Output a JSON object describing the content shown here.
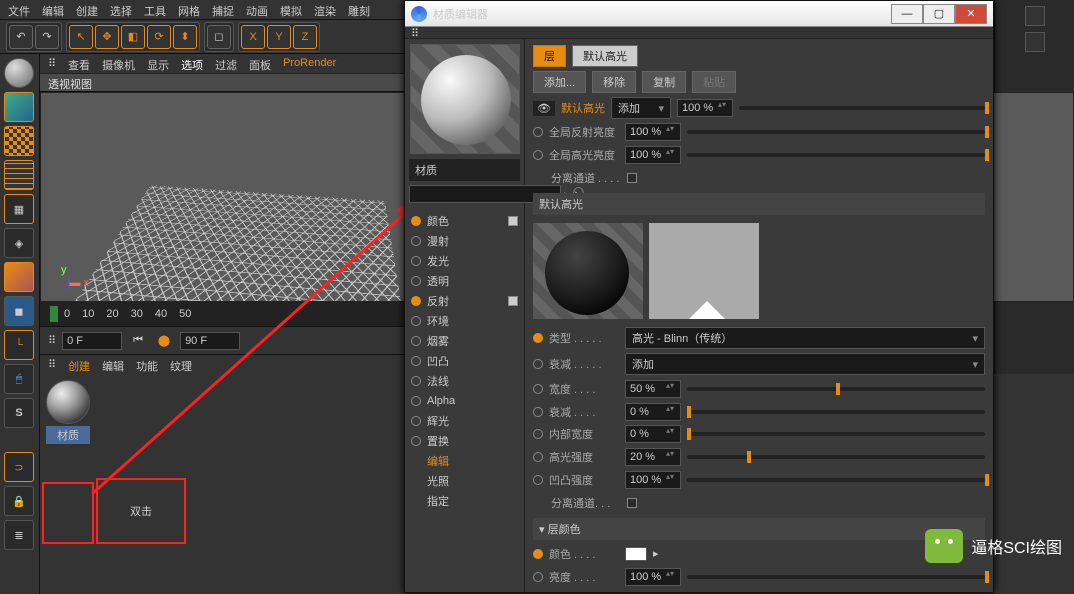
{
  "menu": {
    "file": "文件",
    "edit": "编辑",
    "create": "创建",
    "select": "选择",
    "tool": "工具",
    "mesh": "网格",
    "capture": "捕捉",
    "anim": "动画",
    "sim": "模拟",
    "render": "渲染",
    "sculpt": "雕刻"
  },
  "tool_letters": {
    "x": "X",
    "y": "Y",
    "z": "Z"
  },
  "vpmenu": {
    "view": "查看",
    "camera": "摄像机",
    "display": "显示",
    "options": "选项",
    "filter": "过滤",
    "panel": "面板",
    "pro": "ProRender"
  },
  "vp_label": "透视视图",
  "axis": {
    "x": "x",
    "y": "y"
  },
  "timeline": {
    "ticks": [
      "0",
      "10",
      "20",
      "30",
      "40",
      "50"
    ],
    "g": "0"
  },
  "play": {
    "start": "0 F",
    "end": "90 F"
  },
  "matmenu": {
    "create": "创建",
    "edit": "编辑",
    "fn": "功能",
    "tex": "纹理"
  },
  "mat_label": "材质",
  "doubleclick": "双击",
  "dialog": {
    "title": "材质编辑器",
    "matname": "材质",
    "channels": [
      {
        "name": "颜色",
        "on": true,
        "chk": true
      },
      {
        "name": "漫射",
        "on": false
      },
      {
        "name": "发光",
        "on": false
      },
      {
        "name": "透明",
        "on": false
      },
      {
        "name": "反射",
        "on": true,
        "chk": true,
        "sel": true
      },
      {
        "name": "环境",
        "on": false
      },
      {
        "name": "烟雾",
        "on": false
      },
      {
        "name": "凹凸",
        "on": false
      },
      {
        "name": "法线",
        "on": false
      },
      {
        "name": "Alpha",
        "on": false
      },
      {
        "name": "辉光",
        "on": false
      },
      {
        "name": "置换",
        "on": false
      }
    ],
    "extra": [
      "编辑",
      "光照",
      "指定"
    ],
    "tabs": {
      "layer": "层",
      "spec": "默认高光"
    },
    "ops": {
      "add": "添加...",
      "remove": "移除",
      "copy": "复制",
      "paste": "粘贴"
    },
    "spec_label": "默认高光",
    "add_dd": "添加",
    "pct100": "100 %",
    "global_ref": "全局反射亮度",
    "global_spec": "全局高光亮度",
    "sep_chan": "分离通道 . . . .",
    "sect_spec": "默认高光",
    "type": "类型 . . . . .",
    "type_val": "高光 - Blinn（传统）",
    "atten": "衰减 . . . . .",
    "atten_val": "添加",
    "width": "宽度 . . . .",
    "width_val": "50 %",
    "falloff": "衰减 . . . .",
    "falloff_val": "0 %",
    "inner": "内部宽度",
    "inner_val": "0 %",
    "spec_str": "高光强度",
    "spec_str_val": "20 %",
    "bump_str": "凹凸强度",
    "bump_str_val": "100 %",
    "sep_chan2": "分离通道. . .",
    "layer_color": "▾ 层颜色",
    "color": "颜色 . . . .",
    "bright": "亮度 . . . .",
    "bright_val": "100 %"
  },
  "wm": "逼格SCI绘图"
}
